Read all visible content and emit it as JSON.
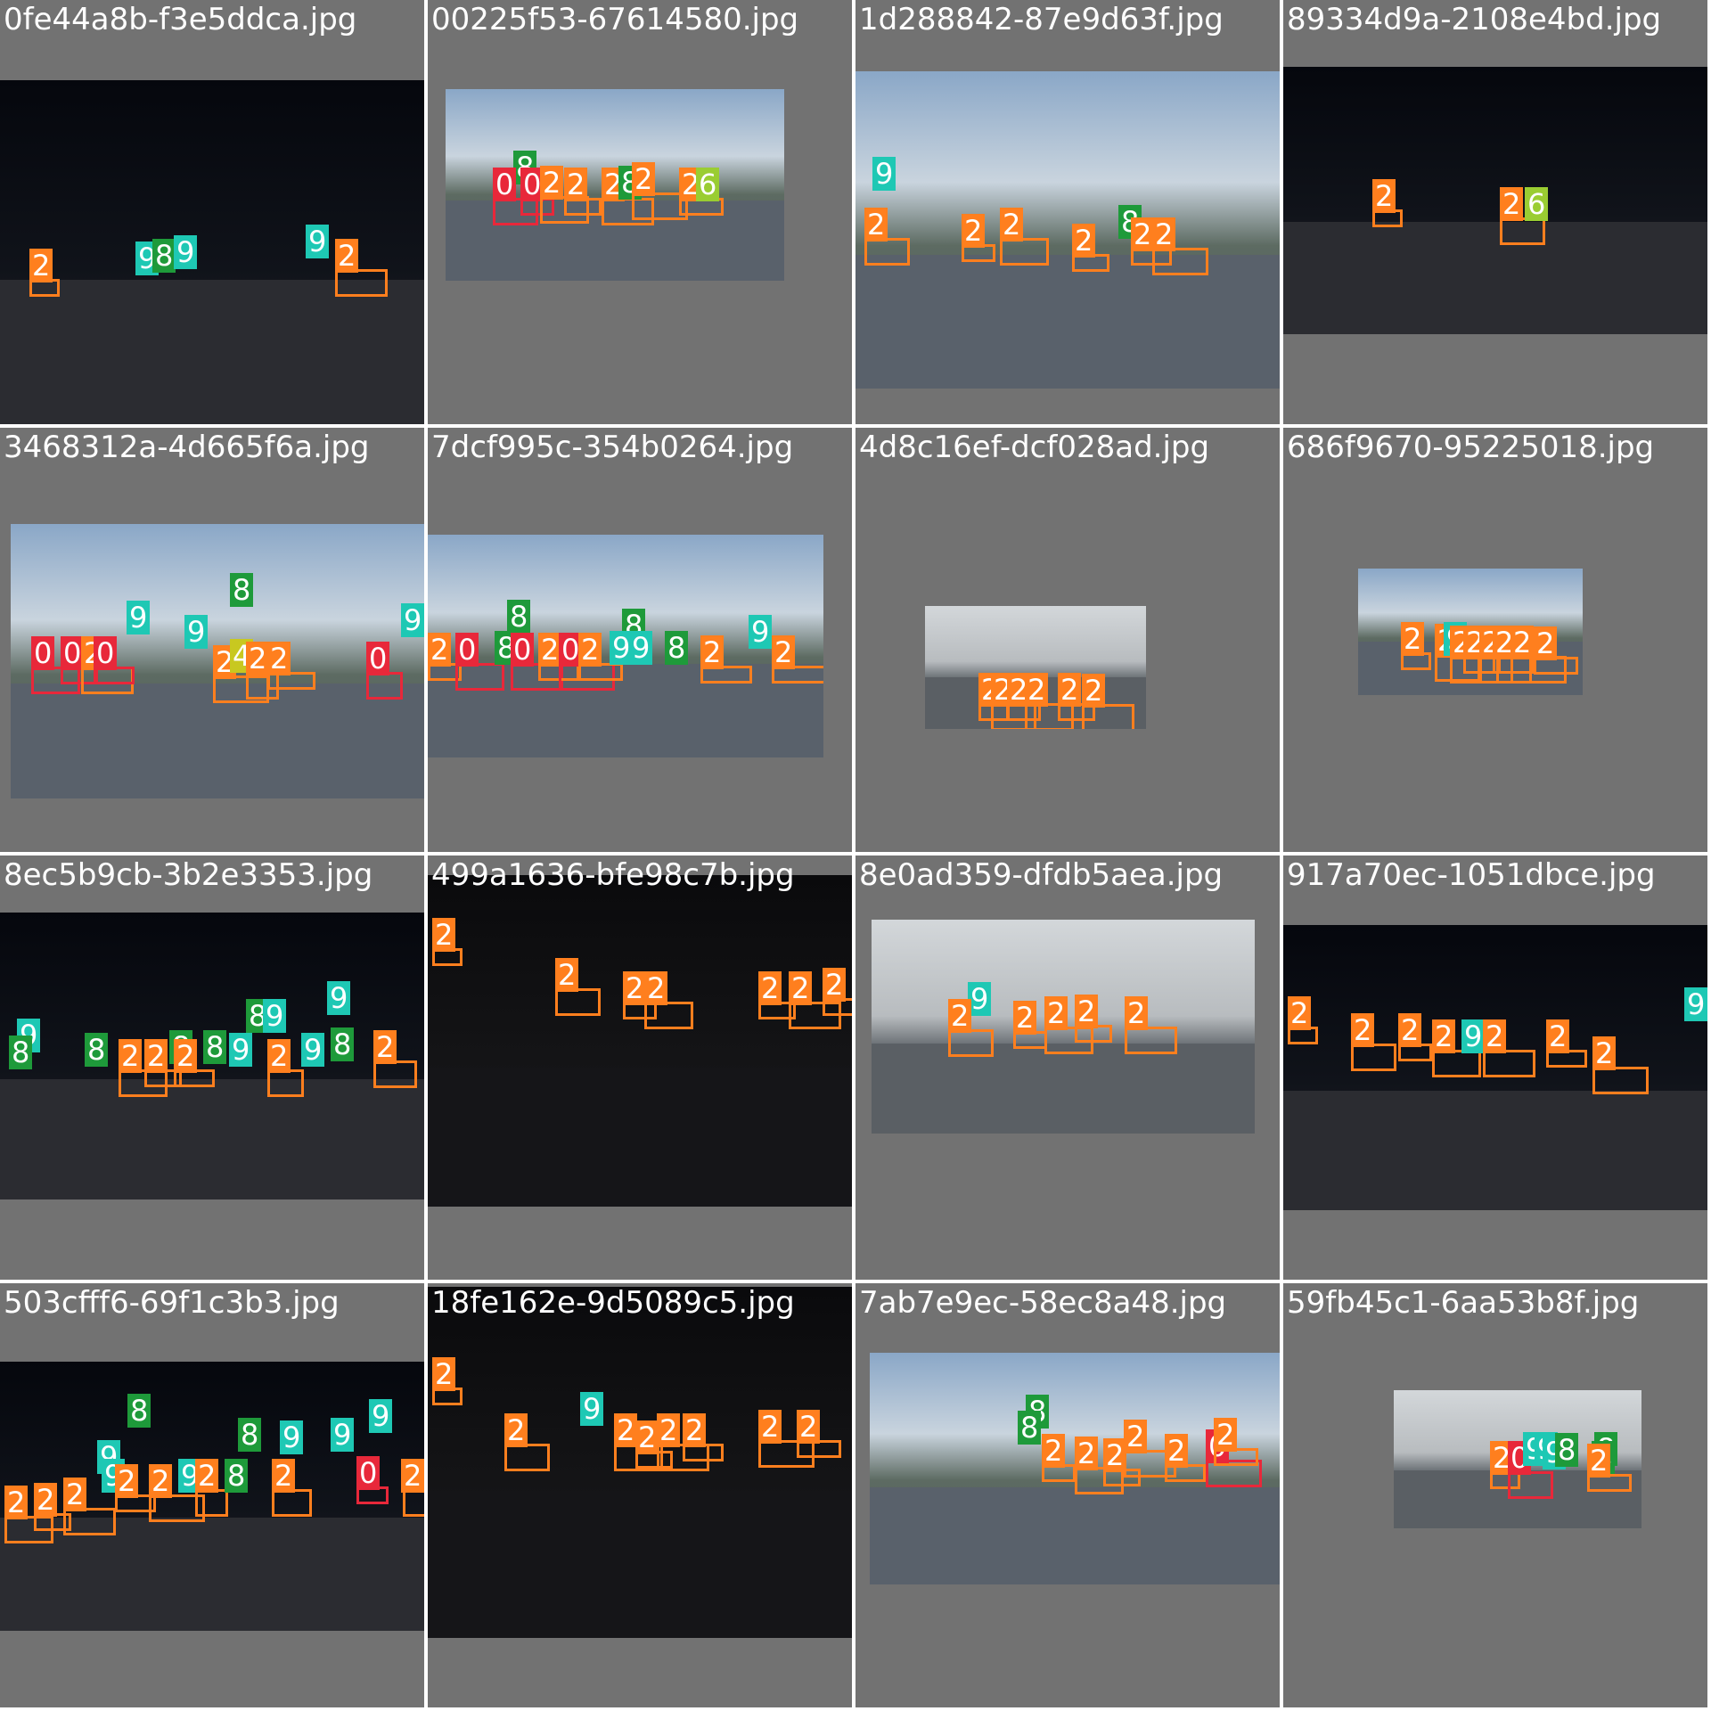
{
  "colors": {
    "0": "#e8283a",
    "2": "#ff7f1e",
    "4": "#c8c820",
    "6": "#9acd32",
    "8": "#1e9a3a",
    "9": "#1ec8b4"
  },
  "tiles": [
    {
      "filename": "0fe44a8b-f3e5ddca.jpg",
      "scene": "night",
      "labels": [
        [
          "2",
          0.07,
          0.49
        ],
        [
          "9",
          0.32,
          0.47
        ],
        [
          "8",
          0.36,
          0.46
        ],
        [
          "9",
          0.41,
          0.45
        ],
        [
          "9",
          0.72,
          0.42
        ],
        [
          "2",
          0.79,
          0.46
        ]
      ]
    },
    {
      "filename": "00225f53-67614580.jpg",
      "scene": "day",
      "labels": [
        [
          "8",
          0.2,
          0.32
        ],
        [
          "0",
          0.14,
          0.41
        ],
        [
          "0",
          0.22,
          0.41
        ],
        [
          "2",
          0.28,
          0.4
        ],
        [
          "2",
          0.35,
          0.41
        ],
        [
          "2",
          0.46,
          0.41
        ],
        [
          "8",
          0.51,
          0.4
        ],
        [
          "2",
          0.55,
          0.38
        ],
        [
          "2",
          0.69,
          0.41
        ],
        [
          "6",
          0.74,
          0.41
        ]
      ]
    },
    {
      "filename": "1d288842-87e9d63f.jpg",
      "scene": "day",
      "labels": [
        [
          "9",
          0.04,
          0.27
        ],
        [
          "2",
          0.02,
          0.43
        ],
        [
          "2",
          0.25,
          0.45
        ],
        [
          "2",
          0.34,
          0.43
        ],
        [
          "2",
          0.51,
          0.48
        ],
        [
          "8",
          0.62,
          0.42
        ],
        [
          "2",
          0.65,
          0.46
        ],
        [
          "2",
          0.7,
          0.46
        ]
      ]
    },
    {
      "filename": "89334d9a-2108e4bd.jpg",
      "scene": "night",
      "labels": [
        [
          "2",
          0.21,
          0.42
        ],
        [
          "2",
          0.51,
          0.45
        ],
        [
          "6",
          0.57,
          0.45
        ]
      ]
    },
    {
      "filename": "3468312a-4d665f6a.jpg",
      "scene": "day",
      "labels": [
        [
          "8",
          0.53,
          0.18
        ],
        [
          "9",
          0.28,
          0.28
        ],
        [
          "9",
          0.42,
          0.33
        ],
        [
          "0",
          0.05,
          0.41
        ],
        [
          "0",
          0.12,
          0.41
        ],
        [
          "2",
          0.17,
          0.41
        ],
        [
          "0",
          0.2,
          0.41
        ],
        [
          "2",
          0.49,
          0.44
        ],
        [
          "4",
          0.53,
          0.42
        ],
        [
          "2",
          0.57,
          0.43
        ],
        [
          "2",
          0.62,
          0.43
        ],
        [
          "0",
          0.86,
          0.43
        ],
        [
          "9",
          0.96,
          0.29
        ]
      ]
    },
    {
      "filename": "7dcf995c-354b0264.jpg",
      "scene": "day",
      "labels": [
        [
          "8",
          0.2,
          0.29
        ],
        [
          "8",
          0.49,
          0.33
        ],
        [
          "2",
          0.0,
          0.44
        ],
        [
          "0",
          0.07,
          0.44
        ],
        [
          "8",
          0.17,
          0.43
        ],
        [
          "0",
          0.21,
          0.44
        ],
        [
          "2",
          0.28,
          0.44
        ],
        [
          "0",
          0.33,
          0.44
        ],
        [
          "2",
          0.38,
          0.44
        ],
        [
          "9",
          0.46,
          0.43
        ],
        [
          "9",
          0.51,
          0.43
        ],
        [
          "8",
          0.6,
          0.43
        ],
        [
          "2",
          0.69,
          0.45
        ],
        [
          "9",
          0.81,
          0.36
        ],
        [
          "2",
          0.87,
          0.45
        ]
      ]
    },
    {
      "filename": "4d8c16ef-dcf028ad.jpg",
      "scene": "overcast",
      "labels": [
        [
          "2",
          0.24,
          0.54
        ],
        [
          "2",
          0.3,
          0.54
        ],
        [
          "2",
          0.37,
          0.54
        ],
        [
          "2",
          0.45,
          0.54
        ],
        [
          "2",
          0.6,
          0.54
        ],
        [
          "2",
          0.71,
          0.55
        ]
      ]
    },
    {
      "filename": "686f9670-95225018.jpg",
      "scene": "day",
      "labels": [
        [
          "2",
          0.19,
          0.42
        ],
        [
          "2",
          0.34,
          0.44
        ],
        [
          "9",
          0.38,
          0.42
        ],
        [
          "2",
          0.41,
          0.45
        ],
        [
          "2",
          0.47,
          0.45
        ],
        [
          "2",
          0.54,
          0.45
        ],
        [
          "2",
          0.6,
          0.45
        ],
        [
          "2",
          0.68,
          0.45
        ],
        [
          "2",
          0.78,
          0.46
        ]
      ]
    },
    {
      "filename": "8ec5b9cb-3b2e3353.jpg",
      "scene": "night",
      "labels": [
        [
          "9",
          0.04,
          0.37
        ],
        [
          "8",
          0.02,
          0.43
        ],
        [
          "8",
          0.2,
          0.42
        ],
        [
          "2",
          0.28,
          0.44
        ],
        [
          "2",
          0.34,
          0.44
        ],
        [
          "8",
          0.4,
          0.41
        ],
        [
          "2",
          0.41,
          0.44
        ],
        [
          "8",
          0.48,
          0.41
        ],
        [
          "9",
          0.54,
          0.42
        ],
        [
          "8",
          0.58,
          0.3
        ],
        [
          "9",
          0.62,
          0.3
        ],
        [
          "2",
          0.63,
          0.44
        ],
        [
          "9",
          0.71,
          0.42
        ],
        [
          "8",
          0.78,
          0.4
        ],
        [
          "9",
          0.77,
          0.24
        ],
        [
          "2",
          0.88,
          0.41
        ]
      ]
    },
    {
      "filename": "499a1636-bfe98c7b.jpg",
      "scene": "dark",
      "labels": [
        [
          "2",
          0.01,
          0.13
        ],
        [
          "2",
          0.3,
          0.25
        ],
        [
          "2",
          0.46,
          0.29
        ],
        [
          "2",
          0.51,
          0.29
        ],
        [
          "2",
          0.78,
          0.29
        ],
        [
          "2",
          0.85,
          0.29
        ],
        [
          "2",
          0.93,
          0.28
        ]
      ]
    },
    {
      "filename": "8e0ad359-dfdb5aea.jpg",
      "scene": "overcast",
      "labels": [
        [
          "9",
          0.25,
          0.29
        ],
        [
          "2",
          0.2,
          0.37
        ],
        [
          "2",
          0.37,
          0.38
        ],
        [
          "2",
          0.45,
          0.36
        ],
        [
          "2",
          0.53,
          0.35
        ],
        [
          "2",
          0.66,
          0.36
        ]
      ]
    },
    {
      "filename": "917a70ec-1051dbce.jpg",
      "scene": "night",
      "labels": [
        [
          "2",
          0.01,
          0.25
        ],
        [
          "2",
          0.16,
          0.31
        ],
        [
          "2",
          0.27,
          0.31
        ],
        [
          "2",
          0.35,
          0.33
        ],
        [
          "9",
          0.42,
          0.33
        ],
        [
          "2",
          0.47,
          0.33
        ],
        [
          "2",
          0.62,
          0.33
        ],
        [
          "2",
          0.73,
          0.39
        ],
        [
          "9",
          0.98,
          0.22
        ]
      ]
    },
    {
      "filename": "503cfff6-69f1c3b3.jpg",
      "scene": "night",
      "labels": [
        [
          "8",
          0.3,
          0.12
        ],
        [
          "9",
          0.23,
          0.29
        ],
        [
          "9",
          0.24,
          0.36
        ],
        [
          "2",
          0.01,
          0.46
        ],
        [
          "2",
          0.08,
          0.45
        ],
        [
          "2",
          0.15,
          0.43
        ],
        [
          "2",
          0.27,
          0.38
        ],
        [
          "2",
          0.35,
          0.38
        ],
        [
          "9",
          0.42,
          0.36
        ],
        [
          "2",
          0.46,
          0.36
        ],
        [
          "8",
          0.53,
          0.36
        ],
        [
          "8",
          0.56,
          0.21
        ],
        [
          "9",
          0.66,
          0.22
        ],
        [
          "2",
          0.64,
          0.36
        ],
        [
          "9",
          0.78,
          0.21
        ],
        [
          "9",
          0.87,
          0.14
        ],
        [
          "0",
          0.84,
          0.35
        ],
        [
          "2",
          0.95,
          0.36
        ]
      ]
    },
    {
      "filename": "18fe162e-9d5089c5.jpg",
      "scene": "dark",
      "labels": [
        [
          "2",
          0.01,
          0.2
        ],
        [
          "2",
          0.18,
          0.36
        ],
        [
          "9",
          0.36,
          0.3
        ],
        [
          "2",
          0.44,
          0.36
        ],
        [
          "2",
          0.49,
          0.38
        ],
        [
          "2",
          0.54,
          0.36
        ],
        [
          "2",
          0.6,
          0.36
        ],
        [
          "2",
          0.78,
          0.35
        ],
        [
          "2",
          0.87,
          0.35
        ]
      ]
    },
    {
      "filename": "7ab7e9ec-58ec8a48.jpg",
      "scene": "day",
      "labels": [
        [
          "8",
          0.38,
          0.18
        ],
        [
          "8",
          0.36,
          0.25
        ],
        [
          "2",
          0.42,
          0.35
        ],
        [
          "2",
          0.5,
          0.36
        ],
        [
          "2",
          0.57,
          0.37
        ],
        [
          "2",
          0.62,
          0.29
        ],
        [
          "2",
          0.72,
          0.35
        ],
        [
          "0",
          0.82,
          0.33
        ],
        [
          "2",
          0.84,
          0.28
        ]
      ]
    },
    {
      "filename": "59fb45c1-6aa53b8f.jpg",
      "scene": "overcast",
      "labels": [
        [
          "2",
          0.39,
          0.37
        ],
        [
          "0",
          0.46,
          0.37
        ],
        [
          "9",
          0.52,
          0.3
        ],
        [
          "9",
          0.57,
          0.3
        ],
        [
          "9",
          0.6,
          0.33
        ],
        [
          "8",
          0.65,
          0.31
        ],
        [
          "8",
          0.81,
          0.3
        ],
        [
          "8",
          0.8,
          0.37
        ],
        [
          "2",
          0.78,
          0.39
        ]
      ]
    }
  ]
}
